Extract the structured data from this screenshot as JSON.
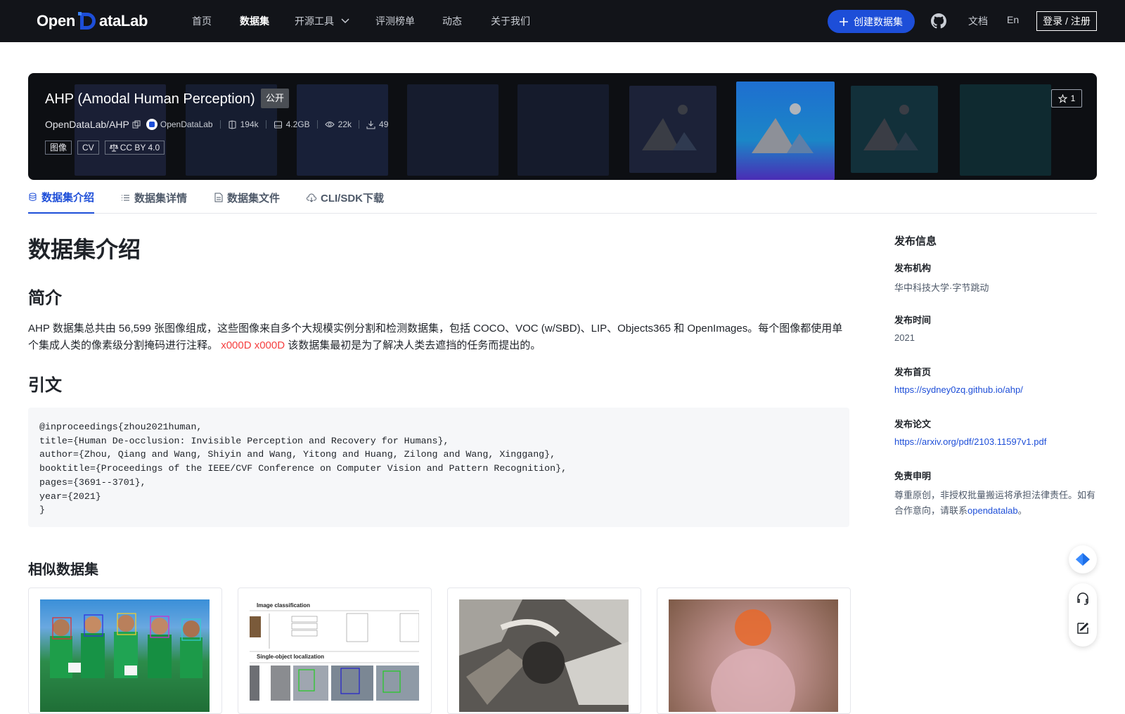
{
  "nav": {
    "logo_text_left": "Open",
    "logo_text_right": "ataLab",
    "links": [
      "首页",
      "数据集",
      "开源工具",
      "评测榜单",
      "动态",
      "关于我们"
    ],
    "create_button": "创建数据集",
    "docs": "文档",
    "lang": "En",
    "login": "登录 / 注册"
  },
  "banner": {
    "title": "AHP (Amodal Human Perception)",
    "visibility": "公开",
    "repo": "OpenDataLab/AHP",
    "org": "OpenDataLab",
    "stats": {
      "files": "194k",
      "size": "4.2GB",
      "views": "22k",
      "downloads": "49"
    },
    "tags": [
      "图像",
      "CV",
      "CC BY 4.0"
    ],
    "stars": "1"
  },
  "tabs": [
    "数据集介绍",
    "数据集详情",
    "数据集文件",
    "CLI/SDK下载"
  ],
  "main": {
    "title": "数据集介绍",
    "section_intro": "简介",
    "intro_text": "AHP 数据集总共由 56,599 张图像组成，这些图像来自多个大规模实例分割和检测数据集，包括 COCO、VOC (w/SBD)、LIP、Objects365 和 OpenImages。每个图像都使用单个集成人类的像素级分割掩码进行注释。",
    "intro_red": "x000D x000D",
    "intro_tail": " 该数据集最初是为了解决人类去遮挡的任务而提出的。",
    "section_citation": "引文",
    "citation": "@inproceedings{zhou2021human,\ntitle={Human De-occlusion: Invisible Perception and Recovery for Humans},\nauthor={Zhou, Qiang and Wang, Shiyin and Wang, Yitong and Huang, Zilong and Wang, Xinggang},\nbooktitle={Proceedings of the IEEE/CVF Conference on Computer Vision and Pattern Recognition},\npages={3691--3701},\nyear={2021}\n}",
    "similar_title": "相似数据集"
  },
  "sidebar": {
    "title": "发布信息",
    "org_label": "发布机构",
    "org_value": "华中科技大学·字节跳动",
    "time_label": "发布时间",
    "time_value": "2021",
    "home_label": "发布首页",
    "home_value": "https://sydney0zq.github.io/ahp/",
    "paper_label": "发布论文",
    "paper_value": "https://arxiv.org/pdf/2103.11597v1.pdf",
    "disclaimer_label": "免责申明",
    "disclaimer_text": "尊重原创，非授权批量搬运将承担法律责任。如有合作意向，请联系",
    "disclaimer_link": "opendatalab",
    "disclaimer_end": "。"
  },
  "card_images": {
    "c2_title_1": "Image classification",
    "c2_title_2": "Single-object localization"
  },
  "colors": {
    "accent": "#1d4ed8",
    "nav_bg": "#121419",
    "red": "#f53f3f"
  }
}
